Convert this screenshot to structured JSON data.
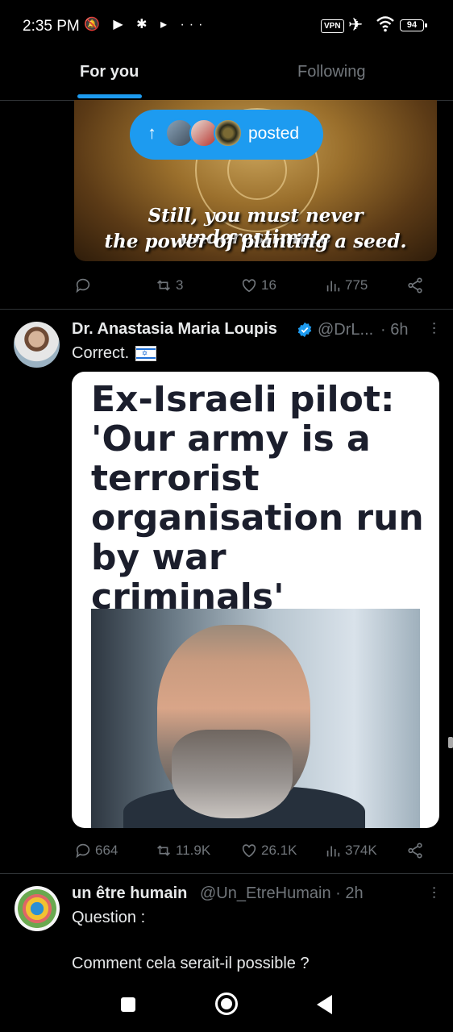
{
  "status_bar": {
    "time": "2:35 PM",
    "left_icons": "🔕 ▶ ✱ ▸ ···",
    "vpn_label": "VPN",
    "battery": "94"
  },
  "tabs": [
    {
      "label": "For you",
      "active": true
    },
    {
      "label": "Following",
      "active": false
    }
  ],
  "accent_color": "#1d9bf0",
  "posted_pill": {
    "label": "posted"
  },
  "post1": {
    "quote_line1": "Still, you must never underestimate",
    "quote_line2": "the power of planting a seed.",
    "stats": {
      "replies": "",
      "reposts": "3",
      "likes": "16",
      "views": "775"
    }
  },
  "post2": {
    "author": "Dr. Anastasia Maria Loupis",
    "handle": "@DrL...",
    "time": "· 6h",
    "text": "Correct.",
    "media_headline": "Ex-Israeli pilot: 'Our army is a terrorist organisation run by war criminals'",
    "stats": {
      "replies": "664",
      "reposts": "11.9K",
      "likes": "26.1K",
      "views": "374K"
    }
  },
  "post3": {
    "author": "un être humain",
    "handle": "@Un_EtreHumain · 2h",
    "line1": "Question :",
    "line2": "Comment cela serait-il possible ?"
  }
}
